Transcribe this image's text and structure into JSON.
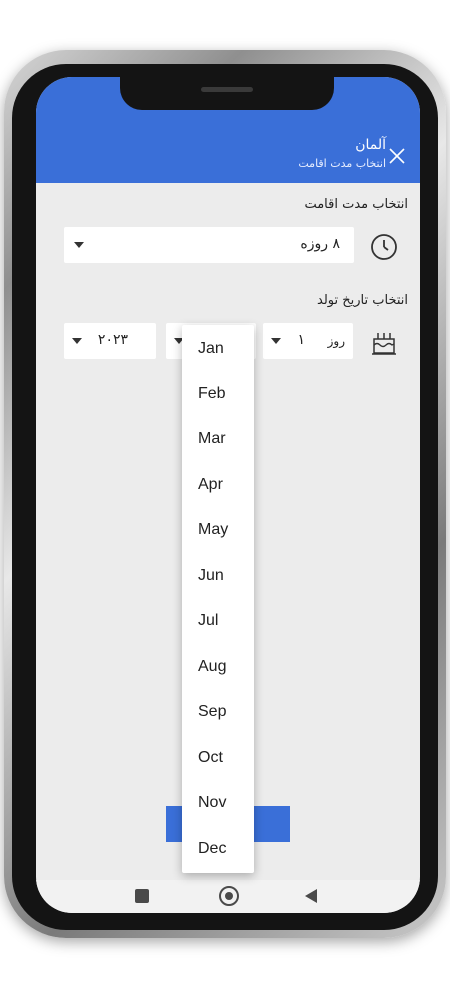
{
  "header": {
    "title": "آلمان",
    "subtitle": "انتخاب مدت اقامت"
  },
  "stay": {
    "label": "انتخاب مدت اقامت",
    "selected": "۸ روزه"
  },
  "birth": {
    "label": "انتخاب تاریخ تولد",
    "day_placeholder": "روز",
    "day_value": "۱",
    "year_value": "۲۰۲۳"
  },
  "month_dropdown": {
    "options": [
      "Jan",
      "Feb",
      "Mar",
      "Apr",
      "May",
      "Jun",
      "Jul",
      "Aug",
      "Sep",
      "Oct",
      "Nov",
      "Dec"
    ]
  },
  "colors": {
    "accent": "#3a6fd8",
    "background": "#ececec"
  },
  "icons": {
    "close": "close-icon",
    "clock": "clock-icon",
    "cake": "cake-icon"
  }
}
